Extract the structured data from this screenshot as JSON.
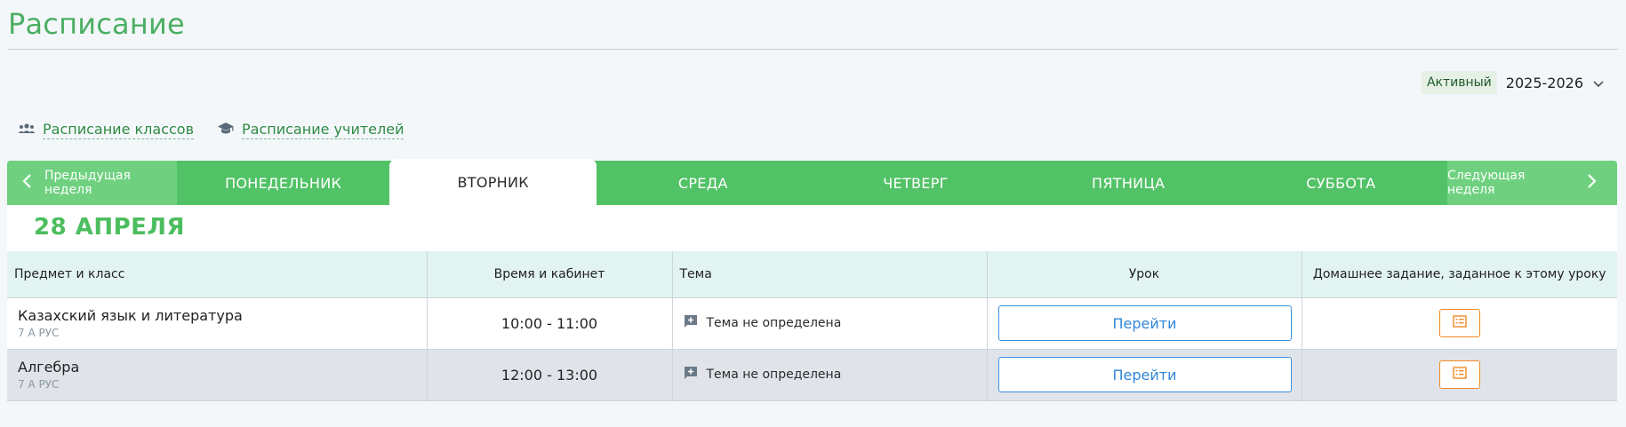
{
  "page": {
    "title": "Расписание"
  },
  "year_selector": {
    "status_badge": "Активный",
    "year": "2025-2026",
    "icon": "chevron-down-icon"
  },
  "links": [
    {
      "label": "Расписание классов",
      "icon": "users-icon"
    },
    {
      "label": "Расписание учителей",
      "icon": "graduation-cap-icon"
    }
  ],
  "week_nav": {
    "prev_label": "Предыдущая неделя",
    "next_label": "Следующая неделя",
    "days": [
      "ПОНЕДЕЛЬНИК",
      "ВТОРНИК",
      "СРЕДА",
      "ЧЕТВЕРГ",
      "ПЯТНИЦА",
      "СУББОТА"
    ],
    "active_day": "ВТОРНИК"
  },
  "date_heading": "28 АПРЕЛЯ",
  "table": {
    "headers": [
      "Предмет и класс",
      "Время и кабинет",
      "Тема",
      "Урок",
      "Домашнее задание, заданное к этому уроку"
    ],
    "rows": [
      {
        "subject": "Казахский язык и литература",
        "class": "7 А РУС",
        "time": "10:00 - 11:00",
        "topic": "Тема не определена",
        "lesson_button": "Перейти"
      },
      {
        "subject": "Алгебра",
        "class": "7 А РУС",
        "time": "12:00 - 13:00",
        "topic": "Тема не определена",
        "lesson_button": "Перейти"
      }
    ]
  },
  "colors": {
    "accent_green": "#52c266",
    "title_green": "#4caf63",
    "link_blue": "#2f86d8",
    "homework_orange": "#f08a24"
  }
}
